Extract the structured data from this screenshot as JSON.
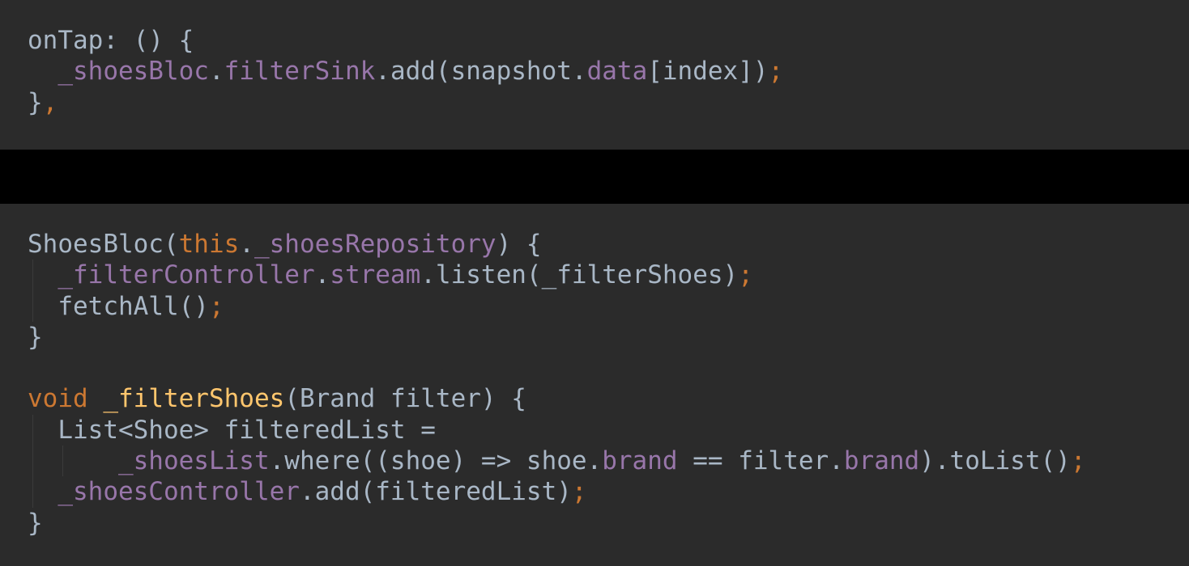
{
  "colors": {
    "background": "#2b2b2b",
    "separator": "#000000",
    "default": "#a9b7c6",
    "field": "#9876aa",
    "keyword": "#cc7832",
    "function": "#ffc66d",
    "guide": "#3b3b3b"
  },
  "top_snippet": {
    "lines": [
      {
        "guides": [],
        "tokens": [
          {
            "t": "onTap: () {",
            "c": "default"
          }
        ]
      },
      {
        "guides": [],
        "tokens": [
          {
            "t": "  ",
            "c": "default"
          },
          {
            "t": "_shoesBloc",
            "c": "field"
          },
          {
            "t": ".",
            "c": "default"
          },
          {
            "t": "filterSink",
            "c": "field"
          },
          {
            "t": ".add(snapshot.",
            "c": "default"
          },
          {
            "t": "data",
            "c": "field"
          },
          {
            "t": "[index])",
            "c": "default"
          },
          {
            "t": ";",
            "c": "keyword"
          }
        ]
      },
      {
        "guides": [],
        "tokens": [
          {
            "t": "}",
            "c": "default"
          },
          {
            "t": ",",
            "c": "keyword"
          }
        ]
      }
    ]
  },
  "bottom_snippet": {
    "lines": [
      {
        "guides": [],
        "tokens": [
          {
            "t": "ShoesBloc(",
            "c": "default"
          },
          {
            "t": "this",
            "c": "keyword"
          },
          {
            "t": ".",
            "c": "default"
          },
          {
            "t": "_shoesRepository",
            "c": "field"
          },
          {
            "t": ") {",
            "c": "default"
          }
        ]
      },
      {
        "guides": [
          0
        ],
        "tokens": [
          {
            "t": "  ",
            "c": "default"
          },
          {
            "t": "_filterController",
            "c": "field"
          },
          {
            "t": ".",
            "c": "default"
          },
          {
            "t": "stream",
            "c": "field"
          },
          {
            "t": ".listen(_filterShoes)",
            "c": "default"
          },
          {
            "t": ";",
            "c": "keyword"
          }
        ]
      },
      {
        "guides": [
          0
        ],
        "tokens": [
          {
            "t": "  fetchAll()",
            "c": "default"
          },
          {
            "t": ";",
            "c": "keyword"
          }
        ]
      },
      {
        "guides": [],
        "tokens": [
          {
            "t": "}",
            "c": "default"
          }
        ]
      },
      {
        "guides": [],
        "tokens": [
          {
            "t": "",
            "c": "default"
          }
        ]
      },
      {
        "guides": [],
        "tokens": [
          {
            "t": "void ",
            "c": "keyword"
          },
          {
            "t": "_filterShoes",
            "c": "function"
          },
          {
            "t": "(Brand filter) {",
            "c": "default"
          }
        ]
      },
      {
        "guides": [
          0
        ],
        "tokens": [
          {
            "t": "  List<Shoe> filteredList =",
            "c": "default"
          }
        ]
      },
      {
        "guides": [
          0,
          2
        ],
        "tokens": [
          {
            "t": "      ",
            "c": "default"
          },
          {
            "t": "_shoesList",
            "c": "field"
          },
          {
            "t": ".where((shoe) => shoe.",
            "c": "default"
          },
          {
            "t": "brand",
            "c": "field"
          },
          {
            "t": " == filter.",
            "c": "default"
          },
          {
            "t": "brand",
            "c": "field"
          },
          {
            "t": ").toList()",
            "c": "default"
          },
          {
            "t": ";",
            "c": "keyword"
          }
        ]
      },
      {
        "guides": [
          0
        ],
        "tokens": [
          {
            "t": "  ",
            "c": "default"
          },
          {
            "t": "_shoesController",
            "c": "field"
          },
          {
            "t": ".add(filteredList)",
            "c": "default"
          },
          {
            "t": ";",
            "c": "keyword"
          }
        ]
      },
      {
        "guides": [],
        "tokens": [
          {
            "t": "}",
            "c": "default"
          }
        ]
      }
    ]
  }
}
